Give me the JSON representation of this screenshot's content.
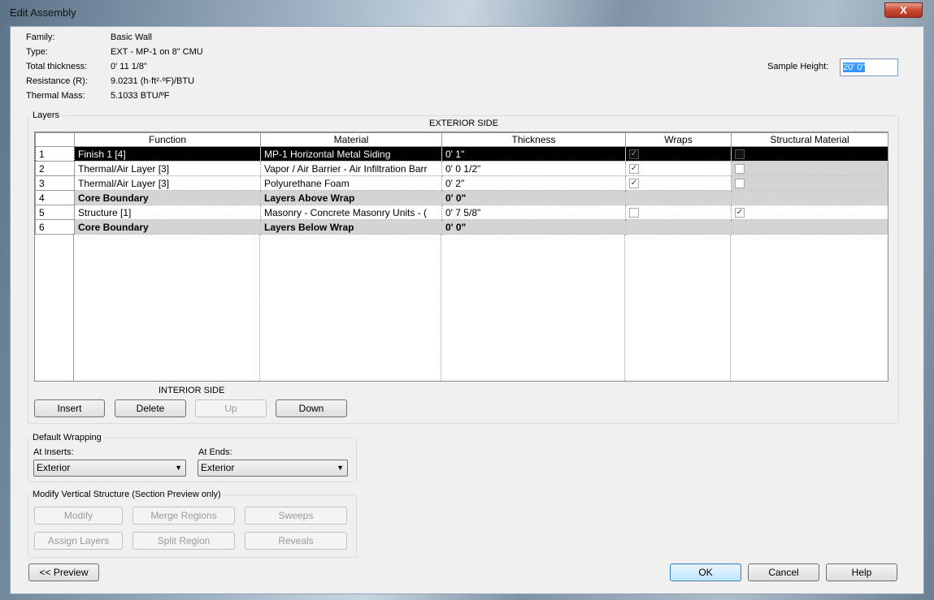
{
  "window": {
    "title": "Edit Assembly",
    "close": "X"
  },
  "info": [
    {
      "label": "Family:",
      "value": "Basic Wall"
    },
    {
      "label": "Type:",
      "value": "EXT - MP-1 on 8\" CMU"
    },
    {
      "label": "Total thickness:",
      "value": "0'  11 1/8\""
    },
    {
      "label": "Resistance (R):",
      "value": "9.0231 (h·ft²·ºF)/BTU"
    },
    {
      "label": "Thermal Mass:",
      "value": "5.1033 BTU/ºF"
    }
  ],
  "sample_height": {
    "label": "Sample Height:",
    "value": "20'  0\""
  },
  "layers": {
    "group_label": "Layers",
    "exterior": "EXTERIOR SIDE",
    "interior": "INTERIOR SIDE",
    "columns": [
      "Function",
      "Material",
      "Thickness",
      "Wraps",
      "Structural Material"
    ],
    "rows": [
      {
        "n": "1",
        "function": "Finish 1 [4]",
        "material": "MP-1 Horizontal Metal Siding",
        "thickness": "0'  1\"",
        "wraps": true,
        "structural": false
      },
      {
        "n": "2",
        "function": "Thermal/Air Layer [3]",
        "material": "Vapor / Air Barrier - Air Infiltration Barr",
        "thickness": "0'  0 1/2\"",
        "wraps": true,
        "structural": false
      },
      {
        "n": "3",
        "function": "Thermal/Air Layer [3]",
        "material": "Polyurethane Foam",
        "thickness": "0'  2\"",
        "wraps": true,
        "structural": false
      },
      {
        "n": "4",
        "function": "Core Boundary",
        "material": "Layers Above Wrap",
        "thickness": "0'  0\""
      },
      {
        "n": "5",
        "function": "Structure [1]",
        "material": "Masonry - Concrete Masonry Units - (",
        "thickness": "0'  7 5/8\"",
        "wraps": false,
        "structural": true
      },
      {
        "n": "6",
        "function": "Core Boundary",
        "material": "Layers Below Wrap",
        "thickness": "0'  0\""
      }
    ],
    "buttons": [
      "Insert",
      "Delete",
      "Up",
      "Down"
    ]
  },
  "wrapping": {
    "group_label": "Default Wrapping",
    "inserts_label": "At Inserts:",
    "inserts_value": "Exterior",
    "ends_label": "At Ends:",
    "ends_value": "Exterior"
  },
  "vertical": {
    "group_label": "Modify Vertical Structure (Section Preview only)",
    "buttons": [
      "Modify",
      "Merge Regions",
      "Sweeps",
      "Assign Layers",
      "Split Region",
      "Reveals"
    ]
  },
  "footer": {
    "preview": "<< Preview",
    "ok": "OK",
    "cancel": "Cancel",
    "help": "Help"
  }
}
